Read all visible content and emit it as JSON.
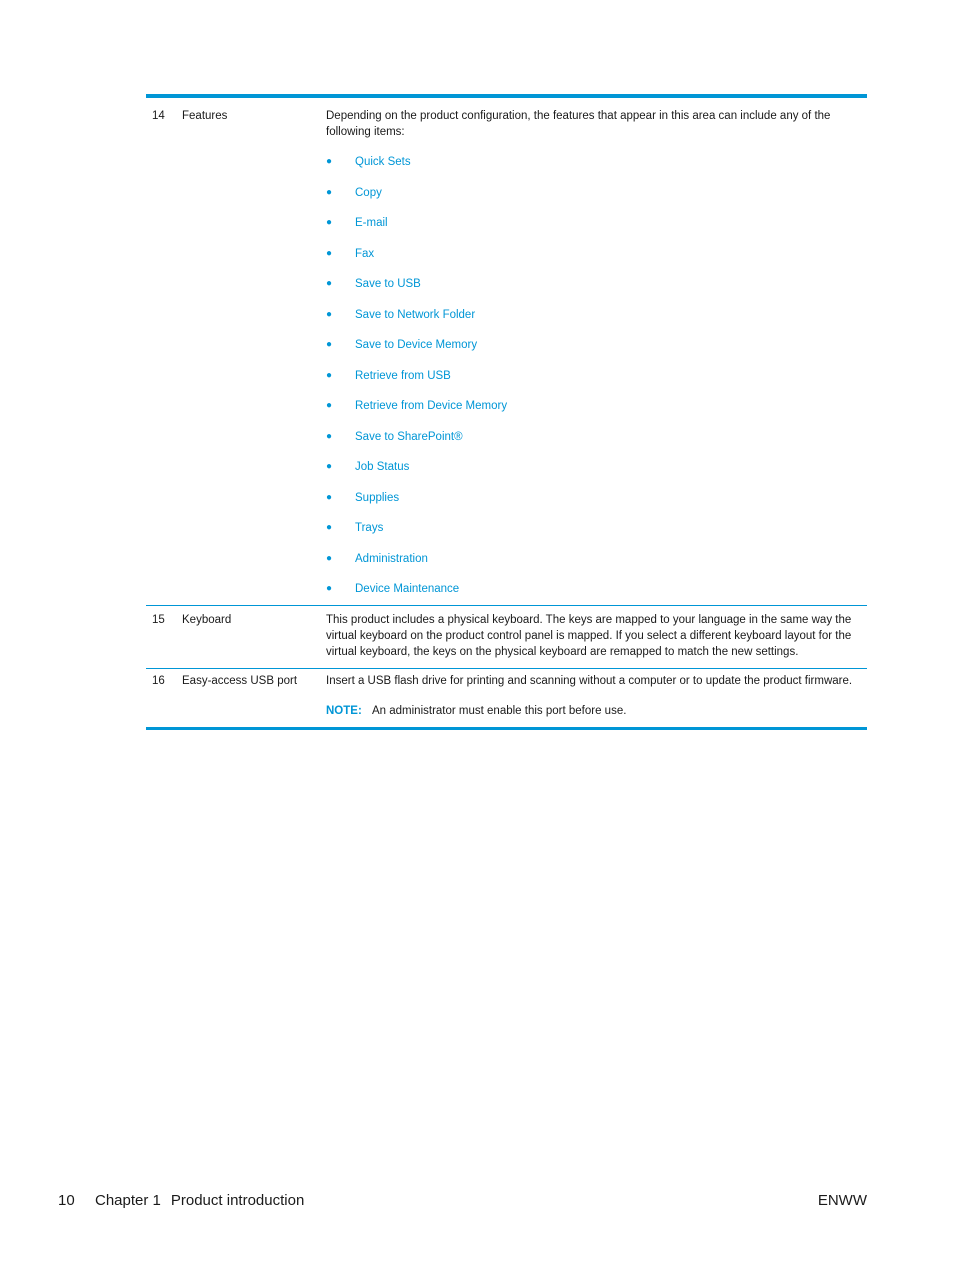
{
  "table": {
    "rows": [
      {
        "number": "14",
        "label": "Features",
        "description": "Depending on the product configuration, the features that appear in this area can include any of the following items:",
        "items": [
          "Quick Sets",
          "Copy",
          "E-mail",
          "Fax",
          "Save to USB",
          "Save to Network Folder",
          "Save to Device Memory",
          "Retrieve from USB",
          "Retrieve from Device Memory",
          "Save to SharePoint®",
          "Job Status",
          "Supplies",
          "Trays",
          "Administration",
          "Device Maintenance"
        ]
      },
      {
        "number": "15",
        "label": "Keyboard",
        "description": "This product includes a physical keyboard. The keys are mapped to your language in the same way the virtual keyboard on the product control panel is mapped. If you select a different keyboard layout for the virtual keyboard, the keys on the physical keyboard are remapped to match the new settings."
      },
      {
        "number": "16",
        "label": "Easy-access USB port",
        "description": "Insert a USB flash drive for printing and scanning without a computer or to update the product firmware.",
        "note_label": "NOTE:",
        "note_text": "An administrator must enable this port before use."
      }
    ]
  },
  "footer": {
    "page_number": "10",
    "chapter": "Chapter 1",
    "chapter_title": "Product introduction",
    "locale": "ENWW"
  },
  "colors": {
    "accent": "#0096d6",
    "text": "#1a1a1a"
  }
}
